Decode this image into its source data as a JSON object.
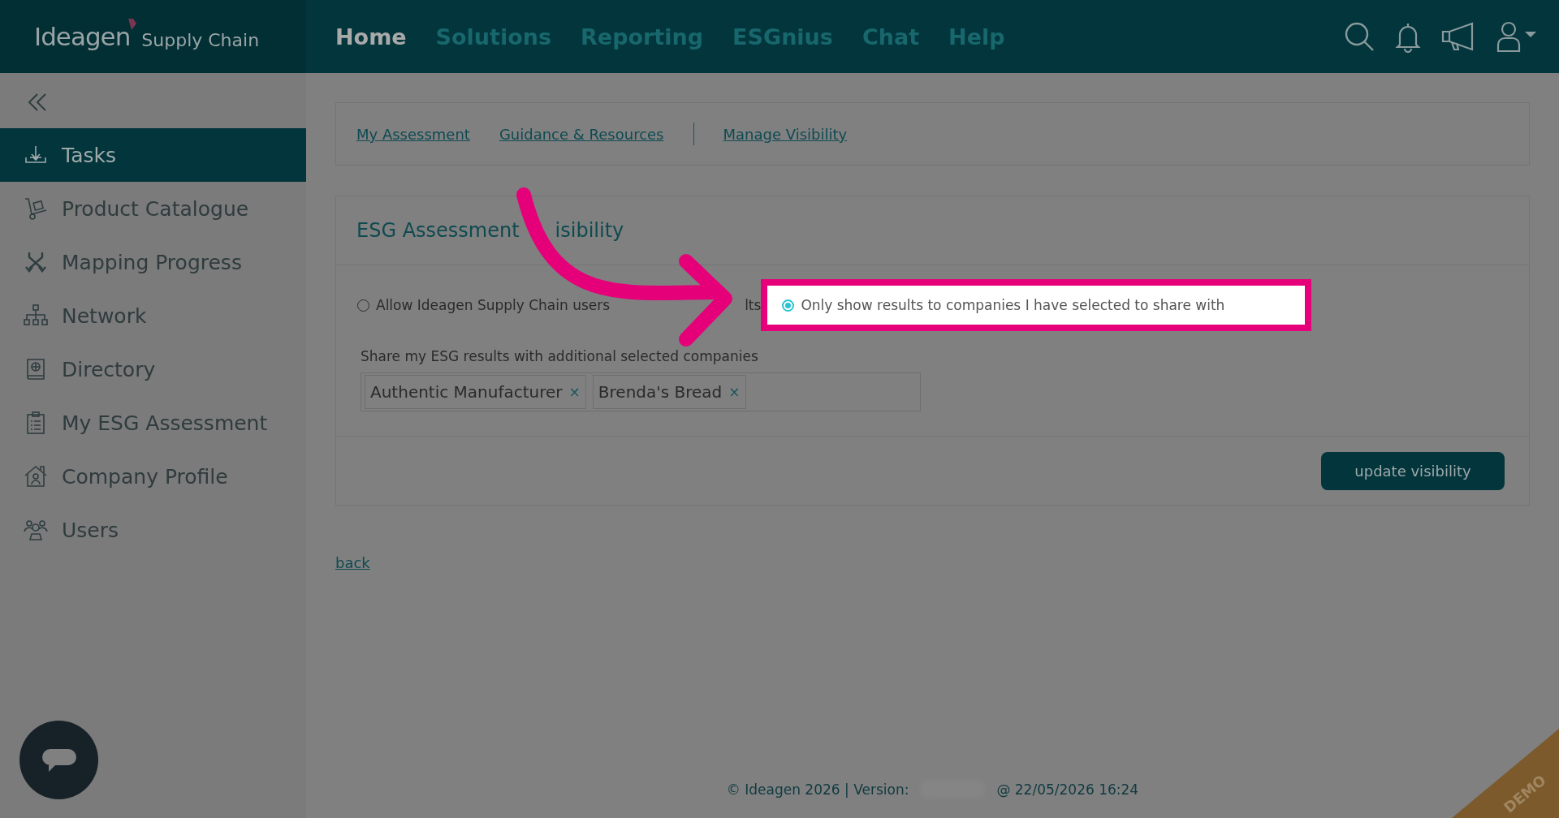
{
  "header": {
    "logo": {
      "brand": "Ideagen",
      "product": "Supply Chain"
    },
    "nav": [
      {
        "label": "Home",
        "selected": true
      },
      {
        "label": "Solutions",
        "selected": false
      },
      {
        "label": "Reporting",
        "selected": false
      },
      {
        "label": "ESGnius",
        "selected": false
      },
      {
        "label": "Chat",
        "selected": false
      },
      {
        "label": "Help",
        "selected": false
      }
    ]
  },
  "sidebar": {
    "items": [
      {
        "label": "Tasks",
        "selected": true
      },
      {
        "label": "Product Catalogue",
        "selected": false
      },
      {
        "label": "Mapping Progress",
        "selected": false
      },
      {
        "label": "Network",
        "selected": false
      },
      {
        "label": "Directory",
        "selected": false
      },
      {
        "label": "My ESG Assessment",
        "selected": false
      },
      {
        "label": "Company Profile",
        "selected": false
      },
      {
        "label": "Users",
        "selected": false
      }
    ]
  },
  "tabs": [
    {
      "label": "My Assessment"
    },
    {
      "label": "Guidance & Resources"
    },
    {
      "label": "Manage Visibility"
    }
  ],
  "panel": {
    "title_parts": [
      "ESG Assessment",
      "isibility"
    ],
    "options": [
      {
        "label": "Allow Ideagen Supply Chain users",
        "label_tail": "lts",
        "selected": false
      },
      {
        "label": "Only show results to companies I have selected to share with",
        "selected": true,
        "highlighted": true
      }
    ],
    "share_label": "Share my ESG results with additional selected companies",
    "tags": [
      {
        "label": "Authentic Manufacturer",
        "remove": "×"
      },
      {
        "label": "Brenda's Bread",
        "remove": "×"
      }
    ],
    "button": "update visibility"
  },
  "back_link": "back",
  "footer": {
    "copyright": "© Ideagen 2026 | Version:",
    "timestamp": "@ 22/05/2026 16:24"
  },
  "ribbon": "DEMO"
}
